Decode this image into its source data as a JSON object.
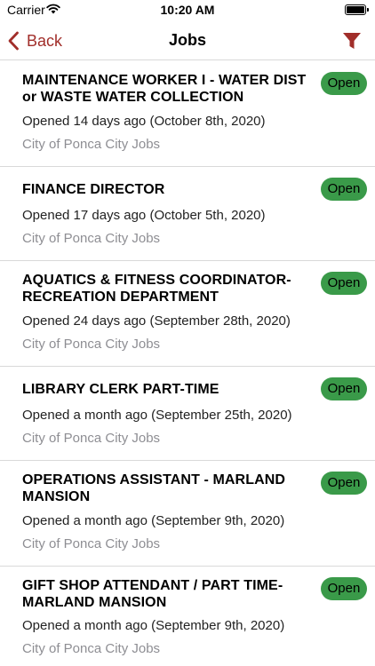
{
  "status_bar": {
    "carrier": "Carrier",
    "time": "10:20 AM"
  },
  "nav": {
    "back_label": "Back",
    "title": "Jobs"
  },
  "colors": {
    "accent": "#a12e2a",
    "open_badge": "#3a9a49",
    "secondary_text": "#8e8e93",
    "divider": "#d9d9d9"
  },
  "icons": {
    "back": "chevron-left-icon",
    "filter": "funnel-icon",
    "wifi": "wifi-icon",
    "battery": "battery-icon"
  },
  "jobs": [
    {
      "title": "MAINTENANCE WORKER I - WATER DIST or WASTE WATER COLLECTION",
      "opened": "Opened 14 days ago (October 8th, 2020)",
      "source": "City of Ponca City Jobs",
      "status": "Open"
    },
    {
      "title": "FINANCE DIRECTOR",
      "opened": "Opened 17 days ago (October 5th, 2020)",
      "source": "City of Ponca City Jobs",
      "status": "Open"
    },
    {
      "title": "AQUATICS & FITNESS COORDINATOR-RECREATION DEPARTMENT",
      "opened": "Opened 24 days ago (September 28th, 2020)",
      "source": "City of Ponca City Jobs",
      "status": "Open"
    },
    {
      "title": "LIBRARY CLERK PART-TIME",
      "opened": "Opened a month ago (September 25th, 2020)",
      "source": "City of Ponca City Jobs",
      "status": "Open"
    },
    {
      "title": "OPERATIONS ASSISTANT - MARLAND MANSION",
      "opened": "Opened a month ago (September 9th, 2020)",
      "source": "City of Ponca City Jobs",
      "status": "Open"
    },
    {
      "title": "GIFT SHOP ATTENDANT / PART TIME-MARLAND MANSION",
      "opened": "Opened a month ago (September 9th, 2020)",
      "source": "City of Ponca City Jobs",
      "status": "Open"
    }
  ]
}
